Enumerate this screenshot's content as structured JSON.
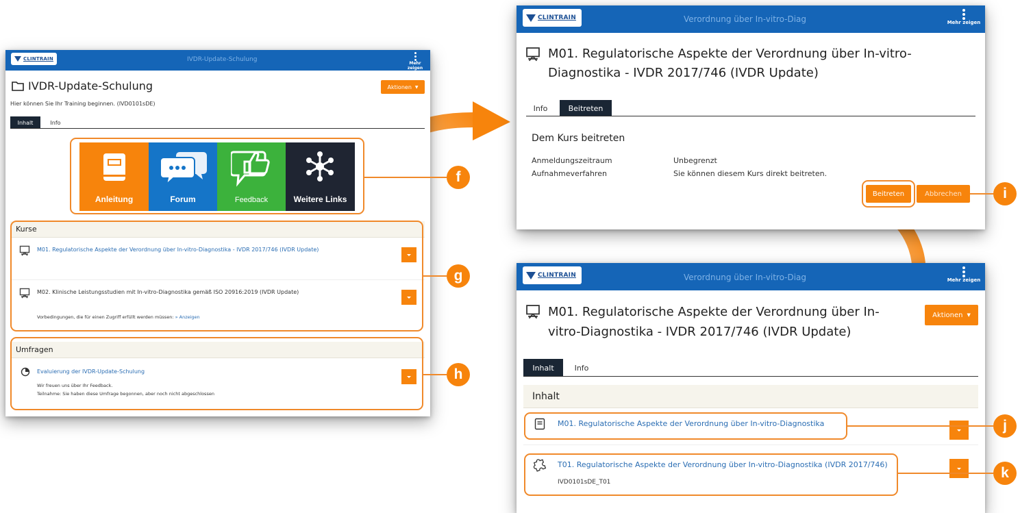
{
  "brand": {
    "logo_text": "CLINTRAIN"
  },
  "colors": {
    "accent": "#f7840c",
    "topbar": "#1565b7",
    "tab_active": "#1a2634",
    "link": "#2a6db3",
    "tile_anleitung": "#f7840c",
    "tile_forum": "#1575c8",
    "tile_feedback": "#3cb23c",
    "tile_weitere": "#1f2532"
  },
  "panel_left": {
    "bar_title": "IVDR-Update-Schulung",
    "more_label": "Mehr zeigen",
    "title": "IVDR-Update-Schulung",
    "subtitle": "Hier können Sie Ihr Training beginnen. (IVD0101sDE)",
    "actions_label": "Aktionen",
    "tabs": [
      {
        "label": "Inhalt"
      },
      {
        "label": "Info"
      }
    ],
    "tiles": [
      {
        "label": "Anleitung",
        "icon": "book-icon"
      },
      {
        "label": "Forum",
        "icon": "chat-bubbles-icon"
      },
      {
        "label": "Feedback",
        "icon": "thumbs-up-icon"
      },
      {
        "label": "Weitere Links",
        "icon": "network-icon"
      }
    ],
    "kurse": {
      "heading": "Kurse",
      "items": [
        {
          "title": "M01. Regulatorische Aspekte der Verordnung über In-vitro-Diagnostika - IVDR 2017/746 (IVDR Update)"
        },
        {
          "title": "M02. Klinische Leistungsstudien mit In-vitro-Diagnostika gemäß ISO 20916:2019 (IVDR Update)",
          "prereq_text": "Vorbedingungen, die für einen Zugriff erfüllt werden müssen:",
          "prereq_link": "» Anzeigen"
        }
      ]
    },
    "umfragen": {
      "heading": "Umfragen",
      "item_title": "Evaluierung der IVDR-Update-Schulung",
      "line1": "Wir freuen uns über Ihr Feedback.",
      "line2": "Teilnahme: Sie haben diese Umfrage begonnen, aber noch nicht abgeschlossen"
    }
  },
  "panel_top_right": {
    "bar_title": "Verordnung über In-vitro-Diag",
    "more_label": "Mehr zeigen",
    "title_line1": "M01. Regulatorische Aspekte der Verordnung über In-vitro-",
    "title_line2": "Diagnostika - IVDR 2017/746 (IVDR Update)",
    "tabs": [
      {
        "label": "Info"
      },
      {
        "label": "Beitreten"
      }
    ],
    "section_title": "Dem Kurs beitreten",
    "fields": [
      {
        "label": "Anmeldungszeitraum",
        "value": "Unbegrenzt"
      },
      {
        "label": "Aufnahmeverfahren",
        "value": "Sie können diesem Kurs direkt beitreten."
      }
    ],
    "join_label": "Beitreten",
    "cancel_label": "Abbrechen"
  },
  "panel_bottom_right": {
    "bar_title": "Verordnung über In-vitro-Diag",
    "more_label": "Mehr zeigen",
    "title_line1": "M01. Regulatorische Aspekte der Verordnung über In-",
    "title_line2": "vitro-Diagnostika - IVDR 2017/746 (IVDR Update)",
    "actions_label": "Aktionen",
    "tabs": [
      {
        "label": "Inhalt"
      },
      {
        "label": "Info"
      }
    ],
    "section_heading": "Inhalt",
    "items": [
      {
        "title": "M01. Regulatorische Aspekte der Verordnung über In-vitro-Diagnostika",
        "icon": "document-icon"
      },
      {
        "title": "T01. Regulatorische Aspekte der Verordnung über In-vitro-Diagnostika (IVDR 2017/746)",
        "sub": "IVD0101sDE_T01",
        "icon": "puzzle-icon"
      }
    ]
  },
  "callouts": [
    "f",
    "g",
    "h",
    "i",
    "j",
    "k"
  ]
}
